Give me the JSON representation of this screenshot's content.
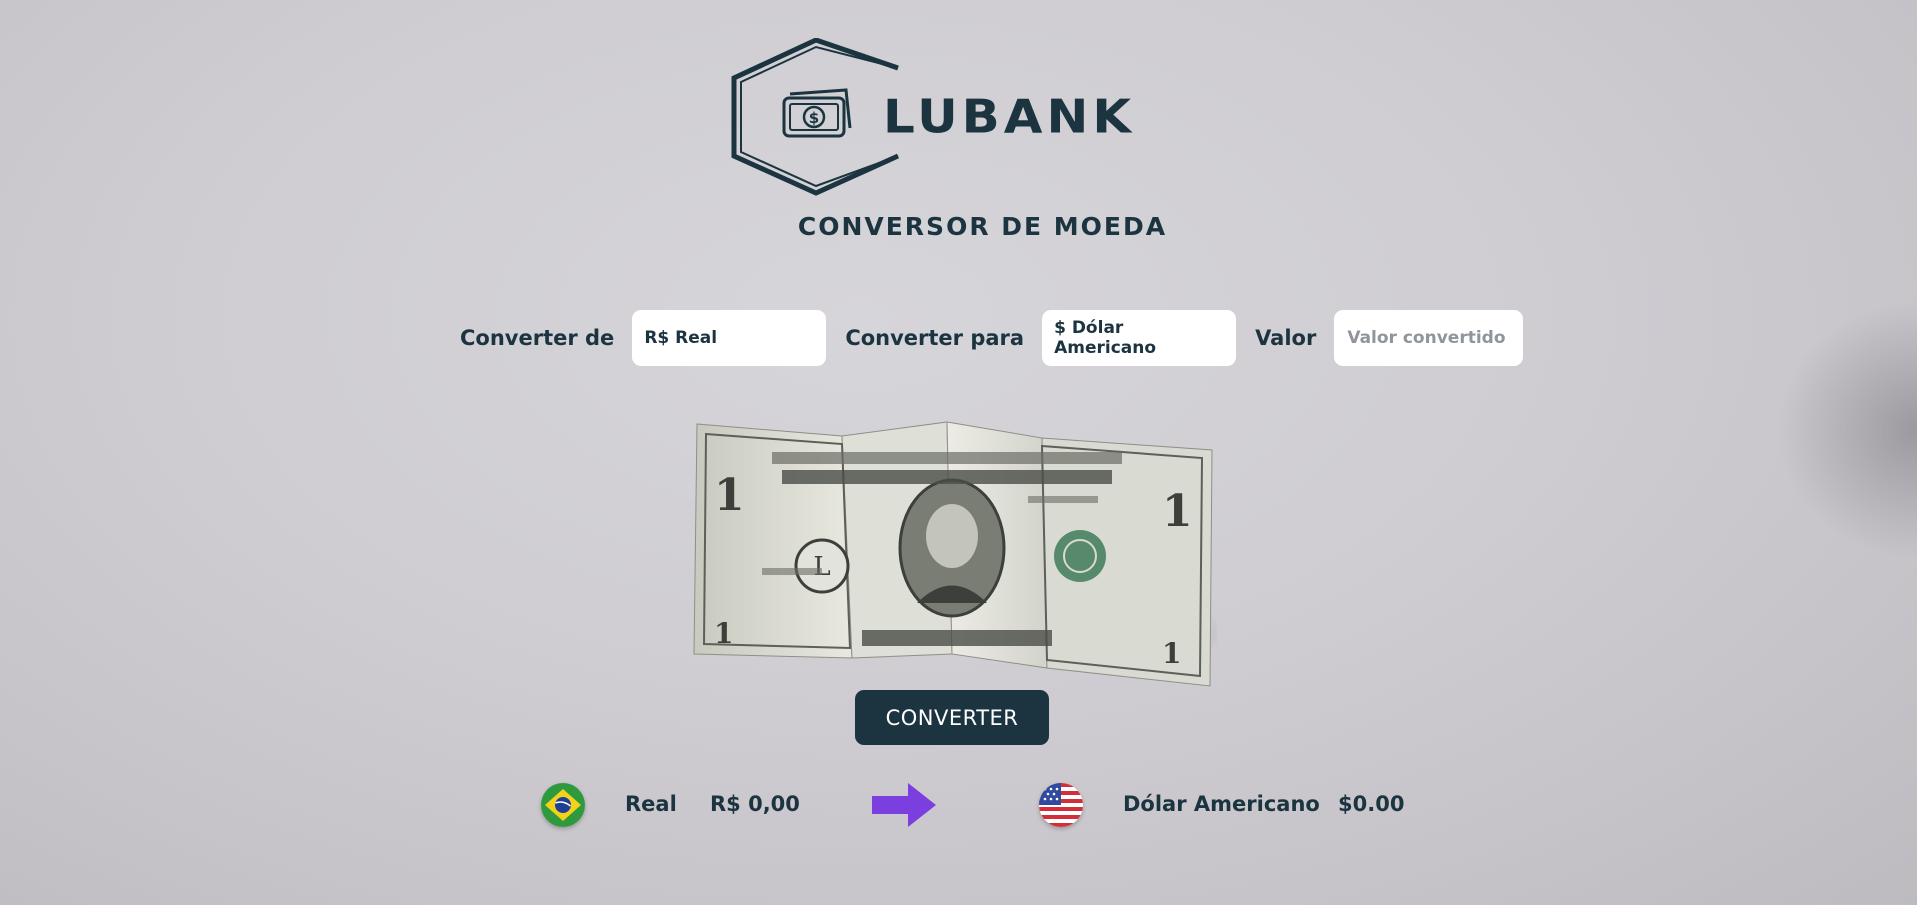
{
  "brand": {
    "name": "LUBANK",
    "logo_icon": "money-bill-icon"
  },
  "subtitle": "CONVERSOR DE MOEDA",
  "form": {
    "from_label": "Converter de",
    "from_value": "R$ Real",
    "to_label": "Converter para",
    "to_value": "$ Dólar Americano",
    "amount_label": "Valor",
    "amount_placeholder": "Valor convertido"
  },
  "convert_button": "CONVERTER",
  "result": {
    "from_currency": "Real",
    "from_amount": "R$ 0,00",
    "to_currency": "Dólar Americano",
    "to_amount": "$0.00",
    "from_flag": "brazil-flag-icon",
    "to_flag": "usa-flag-icon",
    "arrow_icon": "arrow-right-icon",
    "arrow_color": "#7b3fe0"
  },
  "colors": {
    "primary": "#1b3440",
    "input_bg": "#ffffff",
    "background": "#cfcdd2"
  }
}
